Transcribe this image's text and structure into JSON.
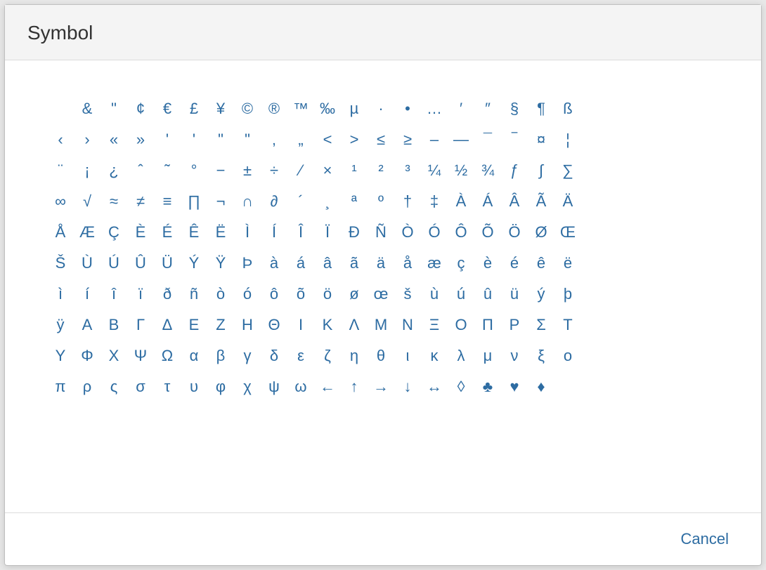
{
  "dialog": {
    "title": "Symbol",
    "cancel_label": "Cancel"
  },
  "symbols": [
    "&",
    "\"",
    "¢",
    "€",
    "£",
    "¥",
    "©",
    "®",
    "™",
    "‰",
    "µ",
    "·",
    "•",
    "…",
    "′",
    "″",
    "§",
    "¶",
    "ß",
    "‹",
    "›",
    "«",
    "»",
    "'",
    "'",
    "\"",
    "\"",
    "‚",
    "„",
    "<",
    ">",
    "≤",
    "≥",
    "–",
    "—",
    "¯",
    "‾",
    "¤",
    "¦",
    "¨",
    "¡",
    "¿",
    "ˆ",
    "˜",
    "°",
    "−",
    "±",
    "÷",
    "⁄",
    "×",
    "¹",
    "²",
    "³",
    "¼",
    "½",
    "¾",
    "ƒ",
    "∫",
    "∑",
    "∞",
    "√",
    "≈",
    "≠",
    "≡",
    "∏",
    "¬",
    "∩",
    "∂",
    "´",
    "¸",
    "ª",
    "º",
    "†",
    "‡",
    "À",
    "Á",
    "Â",
    "Ã",
    "Ä",
    "Å",
    "Æ",
    "Ç",
    "È",
    "É",
    "Ê",
    "Ë",
    "Ì",
    "Í",
    "Î",
    "Ï",
    "Đ",
    "Ñ",
    "Ò",
    "Ó",
    "Ô",
    "Õ",
    "Ö",
    "Ø",
    "Œ",
    "Š",
    "Ù",
    "Ú",
    "Û",
    "Ü",
    "Ý",
    "Ÿ",
    "Þ",
    "à",
    "á",
    "â",
    "ã",
    "ä",
    "å",
    "æ",
    "ç",
    "è",
    "é",
    "ê",
    "ë",
    "ì",
    "í",
    "î",
    "ï",
    "ð",
    "ñ",
    "ò",
    "ó",
    "ô",
    "õ",
    "ö",
    "ø",
    "œ",
    "š",
    "ù",
    "ú",
    "û",
    "ü",
    "ý",
    "þ",
    "ÿ",
    "Α",
    "Β",
    "Γ",
    "Δ",
    "Ε",
    "Ζ",
    "Η",
    "Θ",
    "Ι",
    "Κ",
    "Λ",
    "Μ",
    "Ν",
    "Ξ",
    "Ο",
    "Π",
    "Ρ",
    "Σ",
    "Τ",
    "Υ",
    "Φ",
    "Χ",
    "Ψ",
    "Ω",
    "α",
    "β",
    "γ",
    "δ",
    "ε",
    "ζ",
    "η",
    "θ",
    "ι",
    "κ",
    "λ",
    "μ",
    "ν",
    "ξ",
    "ο",
    "π",
    "ρ",
    "ς",
    "σ",
    "τ",
    "υ",
    "φ",
    "χ",
    "ψ",
    "ω",
    "←",
    "↑",
    "→",
    "↓",
    "↔",
    "◊",
    "♣",
    "♥",
    "♦"
  ]
}
